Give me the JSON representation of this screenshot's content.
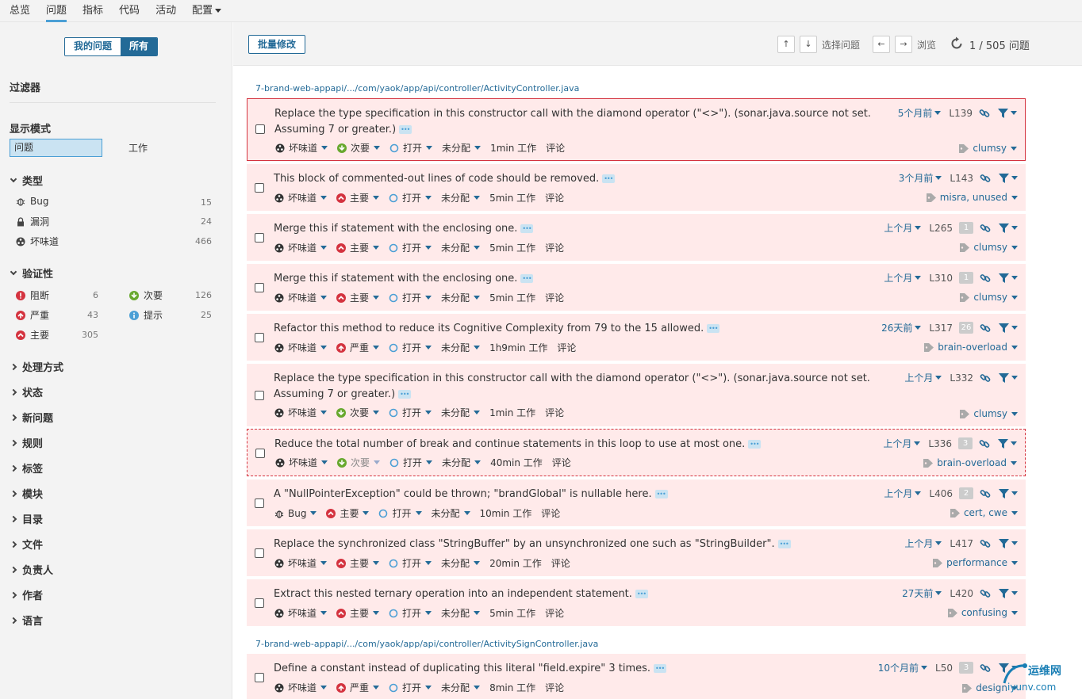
{
  "nav": {
    "items": [
      {
        "label": "总览"
      },
      {
        "label": "问题"
      },
      {
        "label": "指标"
      },
      {
        "label": "代码"
      },
      {
        "label": "活动"
      },
      {
        "label": "配置"
      }
    ],
    "active": 1
  },
  "sidebar": {
    "toggle": {
      "mine": "我的问题",
      "all": "所有"
    },
    "filters_title": "过滤器",
    "display_mode_title": "显示模式",
    "mode_problem": "问题",
    "mode_work": "工作",
    "type": {
      "title": "类型",
      "items": [
        {
          "label": "Bug",
          "count": "15",
          "icon": "bug-icon"
        },
        {
          "label": "漏洞",
          "count": "24",
          "icon": "lock-icon"
        },
        {
          "label": "坏味道",
          "count": "466",
          "icon": "code-smell-icon"
        }
      ]
    },
    "severity": {
      "title": "验证性",
      "items": [
        {
          "label": "阻断",
          "count": "6",
          "icon": "blocker-icon"
        },
        {
          "label": "次要",
          "count": "126",
          "icon": "minor-icon"
        },
        {
          "label": "严重",
          "count": "43",
          "icon": "critical-icon"
        },
        {
          "label": "提示",
          "count": "25",
          "icon": "info-icon"
        },
        {
          "label": "主要",
          "count": "305",
          "icon": "major-icon"
        }
      ]
    },
    "collapsed_facets": [
      "处理方式",
      "状态",
      "新问题",
      "规则",
      "标签",
      "模块",
      "目录",
      "文件",
      "负责人",
      "作者",
      "语言"
    ]
  },
  "toolbar": {
    "bulk_change": "批量修改",
    "up": "↑",
    "down": "↓",
    "select_issues": "选择问题",
    "prev": "←",
    "next": "→",
    "browse": "浏览",
    "counter": "1 / 505 问题"
  },
  "files": [
    "7-brand-web-appapi/.../com/yaok/app/api/controller/ActivityController.java",
    "7-brand-web-appapi/.../com/yaok/app/api/controller/ActivitySignController.java"
  ],
  "issues": [
    {
      "message": "Replace the type specification in this constructor call with the diamond operator (\"<>\"). (sonar.java.source not set. Assuming 7 or greater.)",
      "type": "坏味道",
      "severity": "次要",
      "sev_icon": "minor-icon",
      "status": "打开",
      "assignee": "未分配",
      "effort": "1min 工作",
      "comment": "评论",
      "age": "5个月前",
      "line": "L139",
      "badge": "",
      "tags": "clumsy"
    },
    {
      "message": "This block of commented-out lines of code should be removed.",
      "type": "坏味道",
      "severity": "主要",
      "sev_icon": "major-icon",
      "status": "打开",
      "assignee": "未分配",
      "effort": "5min 工作",
      "comment": "评论",
      "age": "3个月前",
      "line": "L143",
      "badge": "",
      "tags": "misra, unused"
    },
    {
      "message": "Merge this if statement with the enclosing one.",
      "type": "坏味道",
      "severity": "主要",
      "sev_icon": "major-icon",
      "status": "打开",
      "assignee": "未分配",
      "effort": "5min 工作",
      "comment": "评论",
      "age": "上个月",
      "line": "L265",
      "badge": "1",
      "tags": "clumsy"
    },
    {
      "message": "Merge this if statement with the enclosing one.",
      "type": "坏味道",
      "severity": "主要",
      "sev_icon": "major-icon",
      "status": "打开",
      "assignee": "未分配",
      "effort": "5min 工作",
      "comment": "评论",
      "age": "上个月",
      "line": "L310",
      "badge": "1",
      "tags": "clumsy"
    },
    {
      "message": "Refactor this method to reduce its Cognitive Complexity from 79 to the 15 allowed.",
      "type": "坏味道",
      "severity": "严重",
      "sev_icon": "critical-icon",
      "status": "打开",
      "assignee": "未分配",
      "effort": "1h9min 工作",
      "comment": "评论",
      "age": "26天前",
      "line": "L317",
      "badge": "26",
      "tags": "brain-overload"
    },
    {
      "message": "Replace the type specification in this constructor call with the diamond operator (\"<>\"). (sonar.java.source not set. Assuming 7 or greater.)",
      "type": "坏味道",
      "severity": "次要",
      "sev_icon": "minor-icon",
      "status": "打开",
      "assignee": "未分配",
      "effort": "1min 工作",
      "comment": "评论",
      "age": "上个月",
      "line": "L332",
      "badge": "",
      "tags": "clumsy"
    },
    {
      "message": "Reduce the total number of break and continue statements in this loop to use at most one.",
      "type": "坏味道",
      "severity": "次要",
      "sev_icon": "minor-icon",
      "status": "打开",
      "assignee": "未分配",
      "effort": "40min 工作",
      "comment": "评论",
      "age": "上个月",
      "line": "L336",
      "badge": "3",
      "tags": "brain-overload"
    },
    {
      "message": "A \"NullPointerException\" could be thrown; \"brandGlobal\" is nullable here.",
      "type": "Bug",
      "severity": "主要",
      "sev_icon": "major-icon",
      "status": "打开",
      "assignee": "未分配",
      "effort": "10min 工作",
      "comment": "评论",
      "age": "上个月",
      "line": "L406",
      "badge": "2",
      "tags": "cert, cwe"
    },
    {
      "message": "Replace the synchronized class \"StringBuffer\" by an unsynchronized one such as \"StringBuilder\".",
      "type": "坏味道",
      "severity": "主要",
      "sev_icon": "major-icon",
      "status": "打开",
      "assignee": "未分配",
      "effort": "20min 工作",
      "comment": "评论",
      "age": "上个月",
      "line": "L417",
      "badge": "",
      "tags": "performance"
    },
    {
      "message": "Extract this nested ternary operation into an independent statement.",
      "type": "坏味道",
      "severity": "主要",
      "sev_icon": "major-icon",
      "status": "打开",
      "assignee": "未分配",
      "effort": "5min 工作",
      "comment": "评论",
      "age": "27天前",
      "line": "L420",
      "badge": "",
      "tags": "confusing"
    },
    {
      "message": "Define a constant instead of duplicating this literal \"field.expire\" 3 times.",
      "type": "坏味道",
      "severity": "严重",
      "sev_icon": "critical-icon",
      "status": "打开",
      "assignee": "未分配",
      "effort": "8min 工作",
      "comment": "评论",
      "age": "10个月前",
      "line": "L50",
      "badge": "3",
      "tags": "design"
    }
  ],
  "watermark": {
    "line1": "运维网",
    "line2": "iyunv.com"
  },
  "colors": {
    "accent": "#236a97",
    "issue_bg": "#ffeaea",
    "selected_border": "#d4333f",
    "major": "#d4333f",
    "minor": "#68a82e",
    "info": "#4b9fd5"
  }
}
